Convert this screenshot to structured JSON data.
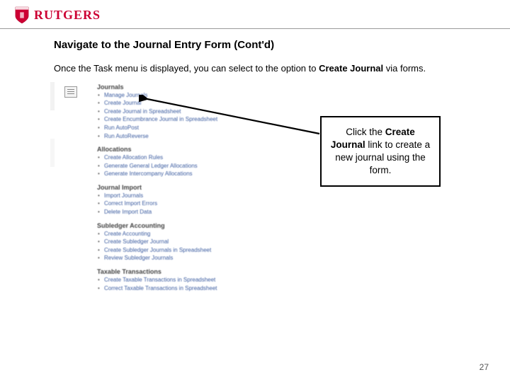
{
  "brand": {
    "name": "RUTGERS"
  },
  "page": {
    "title": "Navigate to the Journal Entry Form (Cont'd)",
    "intro_a": "Once the Task menu is displayed, you can select to the option to ",
    "intro_b_bold": "Create Journal",
    "intro_c": " via forms.",
    "page_number": "27"
  },
  "callout": {
    "t1": "Click the ",
    "b1": "Create Journal",
    "t2": " link to create a new journal using the form."
  },
  "menu": {
    "sections": [
      {
        "heading": "Journals",
        "items": [
          "Manage Journals",
          "Create Journal",
          "Create Journal in Spreadsheet",
          "Create Encumbrance Journal in Spreadsheet",
          "Run AutoPost",
          "Run AutoReverse"
        ]
      },
      {
        "heading": "Allocations",
        "items": [
          "Create Allocation Rules",
          "Generate General Ledger Allocations",
          "Generate Intercompany Allocations"
        ]
      },
      {
        "heading": "Journal Import",
        "items": [
          "Import Journals",
          "Correct Import Errors",
          "Delete Import Data"
        ]
      },
      {
        "heading": "Subledger Accounting",
        "items": [
          "Create Accounting",
          "Create Subledger Journal",
          "Create Subledger Journals in Spreadsheet",
          "Review Subledger Journals"
        ]
      },
      {
        "heading": "Taxable Transactions",
        "items": [
          "Create Taxable Transactions in Spreadsheet",
          "Correct Taxable Transactions in Spreadsheet"
        ]
      }
    ]
  }
}
